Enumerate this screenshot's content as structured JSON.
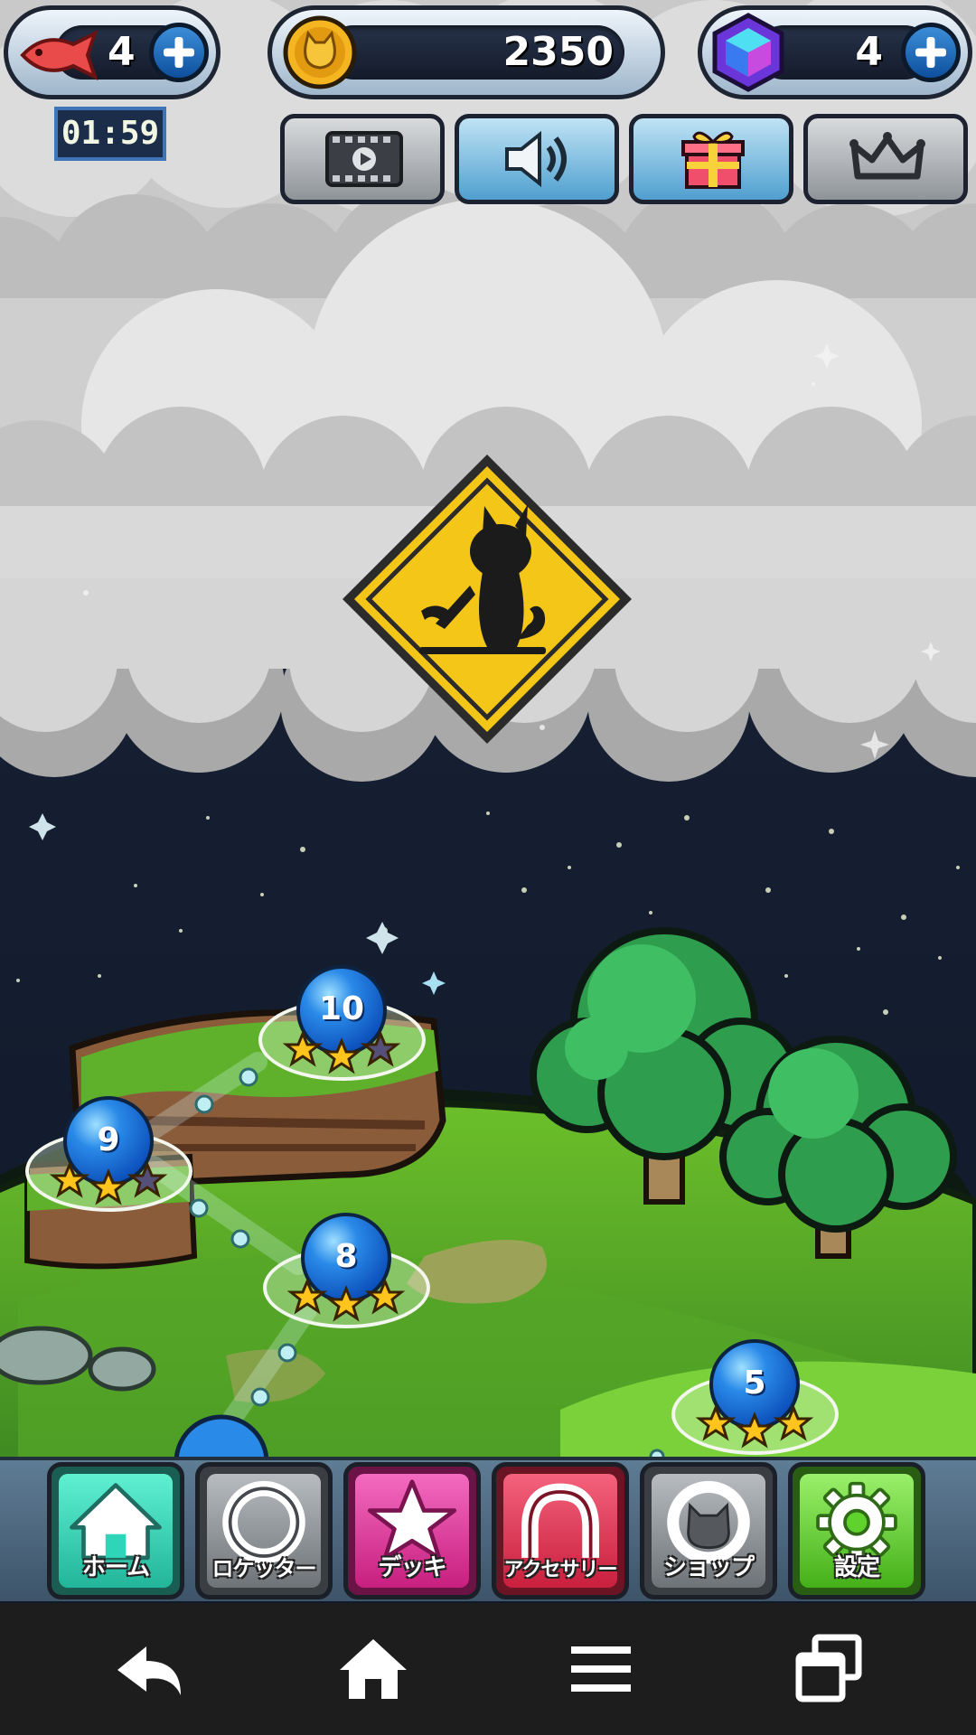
{
  "hud": {
    "fish_count": "4",
    "coin_count": "2350",
    "gem_count": "4",
    "timer": "01:59",
    "icons": {
      "fish": "fish-icon",
      "coin": "cat-coin-icon",
      "gem": "gem-icon",
      "plus": "plus-icon"
    }
  },
  "toolbar": {
    "buttons": [
      {
        "name": "video",
        "icon": "film-play-icon",
        "style": "grey"
      },
      {
        "name": "sound",
        "icon": "speaker-icon",
        "style": "blue"
      },
      {
        "name": "gift",
        "icon": "gift-icon",
        "style": "blue"
      },
      {
        "name": "ranking",
        "icon": "crown-icon",
        "style": "grey"
      }
    ]
  },
  "map": {
    "locked_sign": "construction-cat-sign-icon",
    "levels": [
      {
        "number": "10",
        "stars": 2
      },
      {
        "number": "9",
        "stars": 2
      },
      {
        "number": "8",
        "stars": 3
      },
      {
        "number": "5",
        "stars": 3
      }
    ]
  },
  "menu": {
    "items": [
      {
        "label": "ホーム",
        "icon": "home-icon",
        "color": "#2fd5b8"
      },
      {
        "label": "ロケッター",
        "icon": "ring-icon",
        "color": "#8d9196"
      },
      {
        "label": "デッキ",
        "icon": "star-icon",
        "color": "#e0369b"
      },
      {
        "label": "アクセサリー",
        "icon": "accessory-ring-icon",
        "color": "#e03550"
      },
      {
        "label": "ショップ",
        "icon": "cat-bag-icon",
        "color": "#8d9196"
      },
      {
        "label": "設定",
        "icon": "gear-icon",
        "color": "#5fd22e"
      }
    ]
  },
  "system_nav": {
    "buttons": [
      "back-icon",
      "home-icon",
      "menu-icon",
      "recents-icon"
    ]
  }
}
